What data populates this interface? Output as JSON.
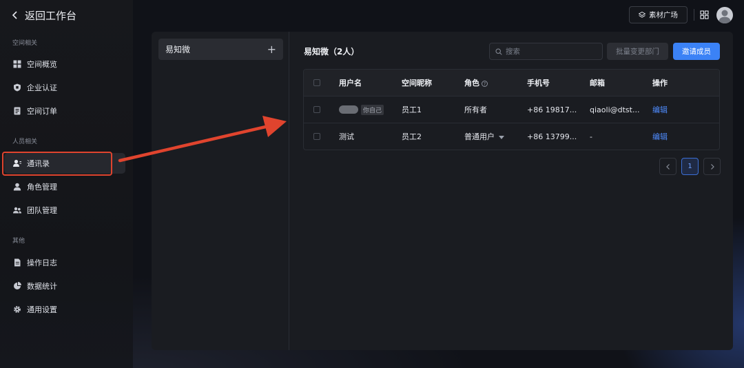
{
  "sidebar": {
    "back_label": "返回工作台",
    "groups": [
      {
        "title": "空间相关",
        "items": [
          {
            "label": "空间概览",
            "icon": "grid-icon"
          },
          {
            "label": "企业认证",
            "icon": "shield-icon"
          },
          {
            "label": "空间订单",
            "icon": "receipt-icon"
          }
        ]
      },
      {
        "title": "人员相关",
        "items": [
          {
            "label": "通讯录",
            "icon": "contacts-icon",
            "active": true
          },
          {
            "label": "角色管理",
            "icon": "user-icon"
          },
          {
            "label": "团队管理",
            "icon": "team-icon"
          }
        ]
      },
      {
        "title": "其他",
        "items": [
          {
            "label": "操作日志",
            "icon": "document-icon"
          },
          {
            "label": "数据统计",
            "icon": "pie-chart-icon"
          },
          {
            "label": "通用设置",
            "icon": "gear-icon"
          }
        ]
      }
    ]
  },
  "header": {
    "material_label": "素材广场"
  },
  "departments": {
    "items": [
      {
        "label": "易知微"
      }
    ]
  },
  "main": {
    "title": "易知微（2人）",
    "search_placeholder": "搜索",
    "batch_button": "批量变更部门",
    "invite_button": "邀请成员",
    "columns": [
      "用户名",
      "空间昵称",
      "角色",
      "手机号",
      "邮箱",
      "操作"
    ],
    "rows": [
      {
        "username": "",
        "self_tag": "你自己",
        "nickname": "员工1",
        "role": "所有者",
        "phone": "+86 19817...",
        "email": "qiaoli@dtst...",
        "action": "编辑"
      },
      {
        "username": "测试",
        "self_tag": "",
        "nickname": "员工2",
        "role": "普通用户",
        "phone": "+86 13799...",
        "email": "-",
        "action": "编辑"
      }
    ]
  },
  "pagination": {
    "current": "1"
  },
  "colors": {
    "accent": "#3b82f6",
    "highlight": "#e0442e",
    "link": "#4f8cff"
  }
}
